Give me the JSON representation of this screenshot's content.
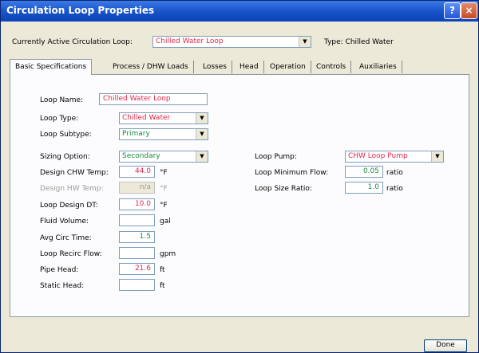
{
  "window": {
    "title": "Circulation Loop Properties"
  },
  "colors": {
    "title_bar": "#1652c8",
    "accent_red": "#e0284a",
    "accent_green": "#1a8a3a",
    "face": "#ece9d8"
  },
  "header": {
    "active_loop_label": "Currently Active Circulation Loop:",
    "active_loop_value": "Chilled Water Loop",
    "type_text": "Type: Chilled Water"
  },
  "tabs": [
    {
      "label": "Basic Specifications"
    },
    {
      "label": "Process / DHW Loads"
    },
    {
      "label": "Losses"
    },
    {
      "label": "Head"
    },
    {
      "label": "Operation"
    },
    {
      "label": "Controls"
    },
    {
      "label": "Auxiliaries"
    }
  ],
  "fields": {
    "loop_name": {
      "label": "Loop Name:",
      "value": "Chilled Water Loop"
    },
    "loop_type": {
      "label": "Loop Type:",
      "value": "Chilled Water"
    },
    "loop_subtype": {
      "label": "Loop Subtype:",
      "value": "Primary"
    },
    "sizing_option": {
      "label": "Sizing Option:",
      "value": "Secondary"
    },
    "design_chw_temp": {
      "label": "Design CHW Temp:",
      "value": "44.0",
      "unit": "°F"
    },
    "design_hw_temp": {
      "label": "Design HW Temp:",
      "value": "n/a",
      "unit": "°F"
    },
    "loop_design_dt": {
      "label": "Loop Design DT:",
      "value": "10.0",
      "unit": "°F"
    },
    "fluid_volume": {
      "label": "Fluid Volume:",
      "value": "",
      "unit": "gal"
    },
    "avg_circ_time": {
      "label": "Avg Circ Time:",
      "value": "1.5"
    },
    "loop_recirc_flow": {
      "label": "Loop Recirc Flow:",
      "value": "",
      "unit": "gpm"
    },
    "pipe_head": {
      "label": "Pipe Head:",
      "value": "21.6",
      "unit": "ft"
    },
    "static_head": {
      "label": "Static Head:",
      "value": "",
      "unit": "ft"
    },
    "loop_pump": {
      "label": "Loop Pump:",
      "value": "CHW Loop Pump"
    },
    "loop_min_flow": {
      "label": "Loop Minimum Flow:",
      "value": "0.05",
      "unit": "ratio"
    },
    "loop_size_ratio": {
      "label": "Loop Size Ratio:",
      "value": "1.0",
      "unit": "ratio"
    }
  },
  "buttons": {
    "done": "Done",
    "help": "?",
    "close": "×"
  }
}
